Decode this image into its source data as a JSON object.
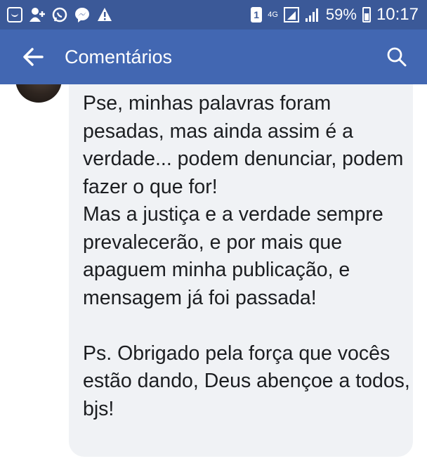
{
  "status_bar": {
    "network": "4G",
    "battery": "59%",
    "time": "10:17",
    "sim_slot": "1"
  },
  "app_bar": {
    "title": "Comentários",
    "back_icon": "arrow-left-icon",
    "search_icon": "search-icon"
  },
  "comment": {
    "paragraph1": "Pse, minhas palavras foram pesadas, mas ainda assim é a verdade... podem denunciar, podem fazer o que for!\nMas a justiça e a verdade sempre  prevalecerão, e por mais que apaguem minha publicação, e mensagem já foi passada!\n\nPs. Obrigado pela força que vocês estão dando, Deus abençoe a todos, bjs!"
  },
  "colors": {
    "status_bar": "#3b5998",
    "app_bar": "#4267b2",
    "bubble": "#f0f2f5",
    "text": "#1c1e21"
  }
}
